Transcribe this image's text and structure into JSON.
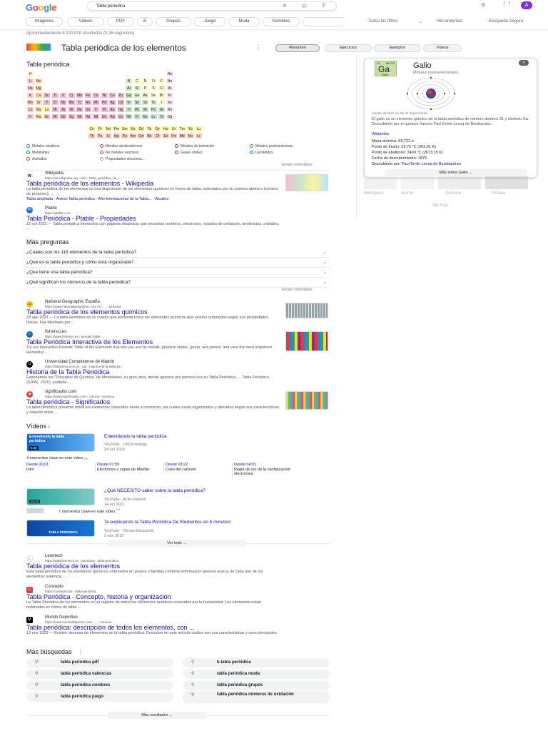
{
  "header": {
    "logo": [
      "G",
      "o",
      "o",
      "g",
      "l",
      "e"
    ],
    "query": "Tabla periodica",
    "avatar": "A",
    "tabs": [
      "Imágenes",
      "Vídeos",
      "PDF",
      "B",
      "Grupos",
      "Juego",
      "Muda",
      "Nombres"
    ],
    "tools": [
      "Todos los filtros",
      "Herramientas",
      "Búsqueda Segura"
    ]
  },
  "stats": "Aproximadamente 8.220.000 resultados (0,26 segundos)",
  "kp": {
    "title": "Tabla periódica de los elementos",
    "pills": [
      "Resumen",
      "Ejercicios",
      "Ejemplos",
      "Vídeos"
    ]
  },
  "ptable": {
    "heading": "Tabla periódica",
    "feedback": "Enviar comentarios",
    "rows": [
      [
        "H",
        "",
        "",
        "",
        "",
        "",
        "",
        "",
        "",
        "",
        "",
        "",
        "",
        "",
        "",
        "",
        "",
        "He"
      ],
      [
        "Li",
        "Be",
        "",
        "",
        "",
        "",
        "",
        "",
        "",
        "",
        "",
        "",
        "B",
        "C",
        "N",
        "O",
        "F",
        "Ne"
      ],
      [
        "Na",
        "Mg",
        "",
        "",
        "",
        "",
        "",
        "",
        "",
        "",
        "",
        "",
        "Al",
        "Si",
        "P",
        "S",
        "Cl",
        "Ar"
      ],
      [
        "K",
        "Ca",
        "Sc",
        "Ti",
        "V",
        "Cr",
        "Mn",
        "Fe",
        "Co",
        "Ni",
        "Cu",
        "Zn",
        "Ga",
        "Ge",
        "As",
        "Se",
        "Br",
        "Kr"
      ],
      [
        "Rb",
        "Sr",
        "Y",
        "Zr",
        "Nb",
        "Mo",
        "Tc",
        "Ru",
        "Rh",
        "Pd",
        "Ag",
        "Cd",
        "In",
        "Sn",
        "Sb",
        "Te",
        "I",
        "Xe"
      ],
      [
        "Cs",
        "Ba",
        "La",
        "Hf",
        "Ta",
        "W",
        "Re",
        "Os",
        "Ir",
        "Pt",
        "Au",
        "Hg",
        "Tl",
        "Pb",
        "Bi",
        "Po",
        "At",
        "Rn"
      ],
      [
        "Fr",
        "Ra",
        "Ac",
        "Rf",
        "Db",
        "Sg",
        "Bh",
        "Hs",
        "Mt",
        "Ds",
        "Rg",
        "Cn",
        "Nh",
        "Fl",
        "Mc",
        "Lv",
        "Ts",
        "Og"
      ]
    ],
    "lan": [
      "Ce",
      "Pr",
      "Nd",
      "Pm",
      "Sm",
      "Eu",
      "Gd",
      "Tb",
      "Dy",
      "Ho",
      "Er",
      "Tm",
      "Yb",
      "Lu"
    ],
    "act": [
      "Th",
      "Pa",
      "U",
      "Np",
      "Pu",
      "Am",
      "Cm",
      "Bk",
      "Cf",
      "Es",
      "Fm",
      "Md",
      "No",
      "Lr"
    ],
    "legend": [
      "Metales alcalinos",
      "Metales alcalinotérreos",
      "Metales de transición",
      "Metales postransiciona...",
      "Metaloides",
      "No metales reactivos",
      "Gases nobles",
      "Lantánidos",
      "Actínidos",
      "Propiedades desconoc..."
    ],
    "colors": {
      "alk": "#ffcdd2",
      "ea": "#ffe0b2",
      "tm": "#f8bbd0",
      "pt": "#c8e6c9",
      "md": "#dcedc8",
      "nm": "#fff9c4",
      "ng": "#fce4ec",
      "la": "#fff59d",
      "ac": "#ffccbc",
      "sel": "#c5e1a5"
    }
  },
  "galio": {
    "num": "31",
    "mass": "69.723",
    "sym": "Ga",
    "name": "Galio",
    "label": "Galio",
    "cat": "Metales postransicionales",
    "caption": "Modelo de Bohr en 3D de Sigrid Gardin",
    "desc": "El galio es un elemento químico de la tabla periódica de número atómico 31 y símbolo Ga. Descubierto por el químico francés Paul Émile Lecoq de Boisbaudra...",
    "wiki": "Wikipedia",
    "facts": [
      "Masa atómica: 69,723 u",
      "Punto de fusión: 29,76 °C (302,91 K)",
      "Punto de ebullición: 2400 °C (2673,15 K)",
      "Fecha de descubrimiento: 1875"
    ],
    "disc_label": "Descubierto por:",
    "disc": "Paul Émile Lecoq de Boisbaudran",
    "more": "Más sobre Galio",
    "below": [
      "Hidrógeno",
      "Átomo",
      "Química",
      "Enlace"
    ],
    "vermas": "Ver más"
  },
  "results1": [
    {
      "site": "Wikipedia",
      "url": "https://es.wikipedia.org › wiki › Tabla_periódica_de_l...",
      "title": "Tabla periódica de los elementos - Wikipedia",
      "snip": "La tabla periódica de los elementos es una disposición de los elementos químicos en forma de tabla, ordenados por su número atómico (número de protones), ...",
      "links": "Tabla ampliada · Anexo:Tabla periódica · Año Internacional de la Tabla... · Alcalino"
    },
    {
      "site": "Ptable",
      "url": "https://ptable.com",
      "title": "Tabla Periódica - Ptable - Propiedades",
      "snip": "12 oct 2022 — Tabla periódica interactiva con páginas dinámicas que muestran nombres, electrones, estados de oxidación, tendencias, orbitales, ..."
    }
  ],
  "paa": {
    "title": "Más preguntas",
    "items": [
      "¿Cuáles son los 118 elementos de la tabla periódica?",
      "¿Qué es la tabla periódica y cómo está organizada?",
      "¿Que tiene una tabla periódica?",
      "¿Qué significan los números de la tabla periódica?"
    ],
    "feedback": "Enviar comentarios"
  },
  "results2": [
    {
      "site": "National Geographic España",
      "url": "https://www.nationalgeographic.com.es › ... › Química",
      "title": "Tabla periódica de los elementos químicos",
      "snip": "28 ago 2023 — La tabla periódica es un cuadro que presenta todos los elementos químicos que existen ordenados según sus propiedades físicas. Fue diseñada por ..."
    },
    {
      "site": "fishersci.es",
      "url": "https://www.fishersci.es › periodic-table",
      "title": "Tabla Periódica Interactiva de los Elementos",
      "snip": "Try our Interactive Periodic Table of the Elements that lets you sort by metals, physical states, group, and period, and view the most important elemental ..."
    },
    {
      "site": "Universidad Complutense de Madrid",
      "url": "https://biblioteca.ucm.es › qui › historia-de-la-tabla-pe...",
      "title": "Historia de la Tabla Periódica",
      "snip": "Exponemos los \"Principios de Química \"de Mendeleiev, su gran obra, donde aparece por primera vez su Tabla Periódica. ... Tabla Periódica (IUPAC 2016). youtube ..."
    },
    {
      "site": "significados.com",
      "url": "https://www.significados.com › Ciencia › Química",
      "title": "Tabla periódica - Significados",
      "snip": "La tabla periódica presenta todos los elementos conocidos hasta el momento, los cuales están organizados y ubicados según sus características y relación entre ..."
    }
  ],
  "videos": {
    "title": "Vídeos",
    "v1": {
      "title": "Entendiendo la tabla periódica",
      "src": "YouTube · UBUinvestiga",
      "date": "24 oct 2019",
      "thumb": "Entendiendo la tabla periódica",
      "dur": "6:55",
      "moments": "4 momentos clave en este vídeo",
      "keys": [
        {
          "t": "Desde 00:01",
          "d": "Intro"
        },
        {
          "t": "Desde 01:59",
          "d": "Electrones y capas de Möeller"
        },
        {
          "t": "Desde 03:22",
          "d": "Caso del carbono"
        },
        {
          "t": "Desde 04:01",
          "d": "Regla de oro de la configuración electrónica"
        }
      ]
    },
    "v2": {
      "title": "¿Qué NECESITO saber sobre la tabla periódica?",
      "src": "YouTube · Al fin entendí",
      "date": "14 oct 2021",
      "dur": "10:43",
      "moments": "7 momentos clave en este vídeo"
    },
    "v3": {
      "title": "Te explicamos la Tabla Periódica De Elementos en 5 minutos!",
      "src": "YouTube · Tomas Educación",
      "date": "2 nov 2019",
      "thumb": "TABLA PERIODICA"
    },
    "all": "Ver todo"
  },
  "results3": [
    {
      "site": "Lenntech",
      "url": "https://www.lenntech.es › periodica › tabla-periodica",
      "title": "Tabla periódica de los elementos",
      "snip": "Esta tabla periódica de los elementos químicos ordenados en grupos o familias contiene información general acerca de cada uno de los elementos (valencia, ..."
    },
    {
      "site": "Concepto",
      "url": "https://concepto.de › tabla-periodica",
      "title": "Tabla Periódica - Concepto, historia y organización",
      "snip": "La Tabla Periódica de los elementos es un registro de todos los elementos químicos conocidos por la humanidad. Los elementos están ordenados en forma de tabla ..."
    },
    {
      "site": "Mundo Deportivo",
      "url": "https://www.mundodeportivo.com › ... › Ciencia",
      "title": "Tabla periódica: descripción de todos los elementos, con ...",
      "snip": "13 ene 2023 — Existen decenas de elementos en la tabla periódica. Descubre en este artículo cuáles son sus características y usos principales."
    }
  ],
  "related": {
    "title": "Más búsquedas",
    "items": [
      "tabla periódica pdf",
      "b tabla periódica",
      "tabla periódica valencias",
      "tabla periódica muda",
      "tabla periódica nombres",
      "tabla periódica grupos",
      "tabla periódica juego",
      "tabla periódica números de oxidación"
    ]
  },
  "more": "Más resultados"
}
